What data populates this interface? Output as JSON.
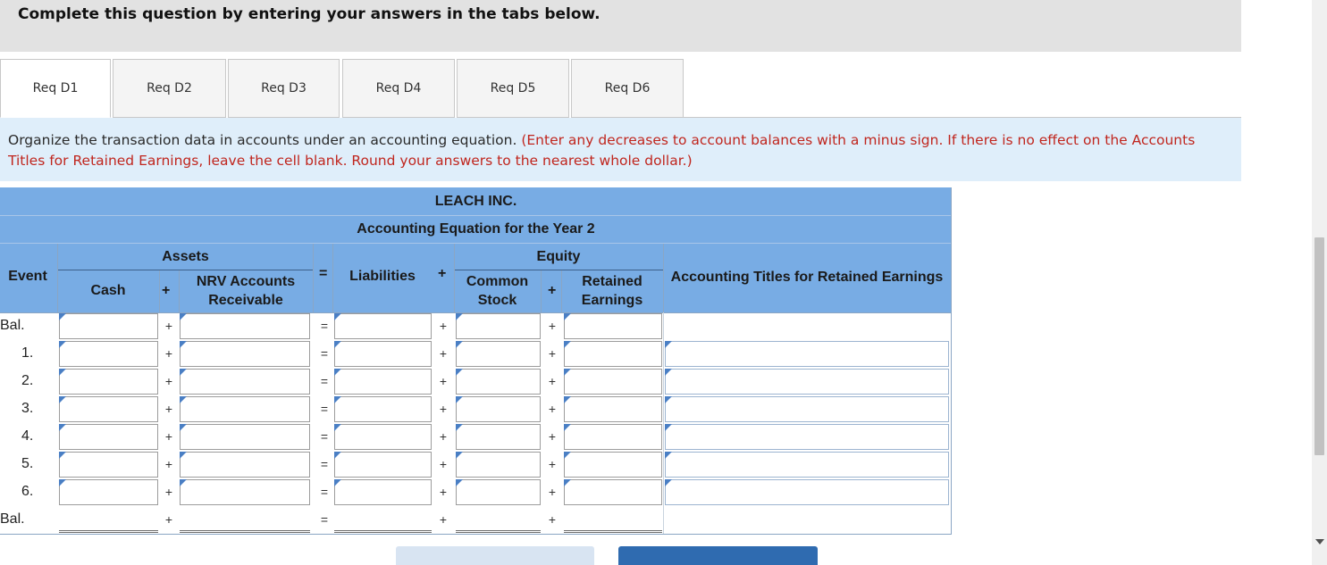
{
  "banner": {
    "title": "Complete this question by entering your answers in the tabs below."
  },
  "tabs": [
    {
      "label": "Req D1",
      "active": true
    },
    {
      "label": "Req D2"
    },
    {
      "label": "Req D3"
    },
    {
      "label": "Req D4"
    },
    {
      "label": "Req D5"
    },
    {
      "label": "Req D6"
    }
  ],
  "instructions": {
    "text": "Organize the transaction data in accounts under an accounting equation.",
    "note": "(Enter any decreases to account balances with a minus sign. If there is no effect on the Accounts Titles for Retained Earnings, leave the cell blank. Round your answers to the nearest whole dollar.)"
  },
  "table": {
    "company": "LEACH INC.",
    "subtitle": "Accounting Equation for the Year 2",
    "groups": {
      "assets": "Assets",
      "equity": "Equity"
    },
    "columns": {
      "event": "Event",
      "cash": "Cash",
      "nrv": "NRV Accounts Receivable",
      "liabilities": "Liabilities",
      "common": "Common Stock",
      "retained": "Retained Earnings",
      "titles": "Accounting Titles for Retained Earnings"
    },
    "operators": {
      "plus": "+",
      "equals": "="
    },
    "rows": [
      {
        "label": "Bal."
      },
      {
        "label": "1."
      },
      {
        "label": "2."
      },
      {
        "label": "3."
      },
      {
        "label": "4."
      },
      {
        "label": "5."
      },
      {
        "label": "6."
      },
      {
        "label": "Bal."
      }
    ]
  },
  "colors": {
    "header": "#78ace4",
    "instructions_bg": "#dfeefa",
    "note": "#c0261e",
    "next_button": "#2f6bb0"
  }
}
